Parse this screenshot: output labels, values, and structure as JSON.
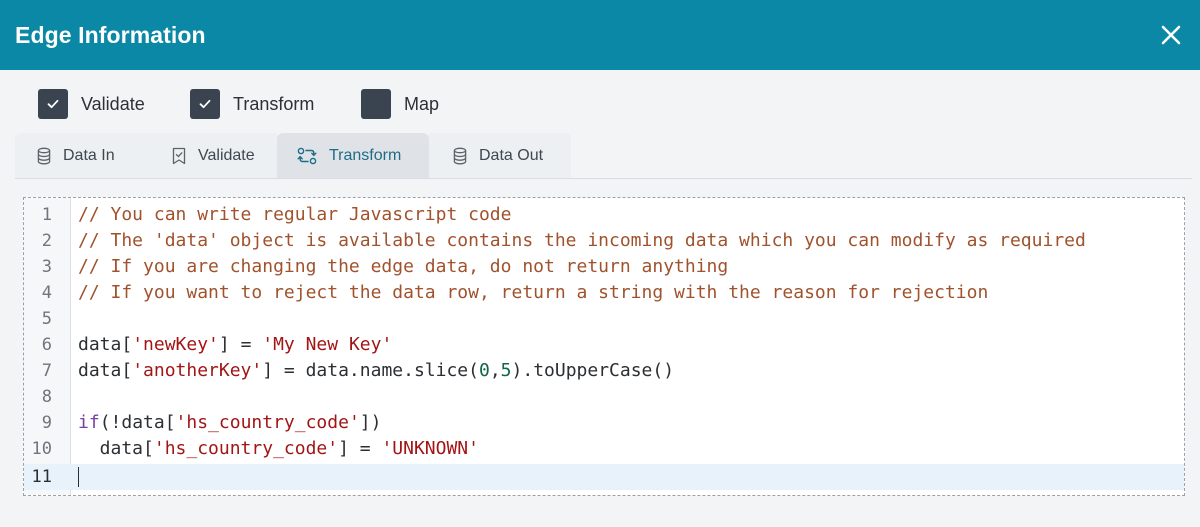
{
  "header": {
    "title": "Edge Information",
    "close_icon": "close-icon"
  },
  "checkboxes": [
    {
      "label": "Validate",
      "checked": true
    },
    {
      "label": "Transform",
      "checked": true
    },
    {
      "label": "Map",
      "checked": false
    }
  ],
  "tabs": [
    {
      "label": "Data In",
      "icon": "database-icon",
      "active": false
    },
    {
      "label": "Validate",
      "icon": "bookmark-check-icon",
      "active": false
    },
    {
      "label": "Transform",
      "icon": "transform-icon",
      "active": true
    },
    {
      "label": "Data Out",
      "icon": "database-icon",
      "active": false
    }
  ],
  "editor": {
    "line_numbers": [
      "1",
      "2",
      "3",
      "4",
      "5",
      "6",
      "7",
      "8",
      "9",
      "10",
      "11"
    ],
    "lines": [
      "// You can write regular Javascript code",
      "// The 'data' object is available contains the incoming data which you can modify as required",
      "// If you are changing the edge data, do not return anything",
      "// If you want to reject the data row, return a string with the reason for rejection",
      "",
      "data['newKey'] = 'My New Key'",
      "data['anotherKey'] = data.name.slice(0,5).toUpperCase()",
      "",
      "if(!data['hs_country_code'])",
      "  data['hs_country_code'] = 'UNKNOWN'",
      ""
    ],
    "tokens": {
      "l6_a": "data[",
      "l6_s1": "'newKey'",
      "l6_b": "] = ",
      "l6_s2": "'My New Key'",
      "l7_a": "data[",
      "l7_s1": "'anotherKey'",
      "l7_b": "] = data.name.slice(",
      "l7_n1": "0",
      "l7_c": ",",
      "l7_n2": "5",
      "l7_d": ").toUpperCase()",
      "l9_k": "if",
      "l9_a": "(!data[",
      "l9_s": "'hs_country_code'",
      "l9_b": "])",
      "l10_a": "  data[",
      "l10_s1": "'hs_country_code'",
      "l10_b": "] = ",
      "l10_s2": "'UNKNOWN'"
    },
    "colors": {
      "comment": "#a0522d",
      "string": "#a31515",
      "number": "#116644",
      "keyword": "#7a3ea0"
    }
  },
  "colors": {
    "header_bg": "#0a88a6",
    "checkbox_bg": "#3a4350",
    "active_tab_text": "#1f6c86"
  }
}
